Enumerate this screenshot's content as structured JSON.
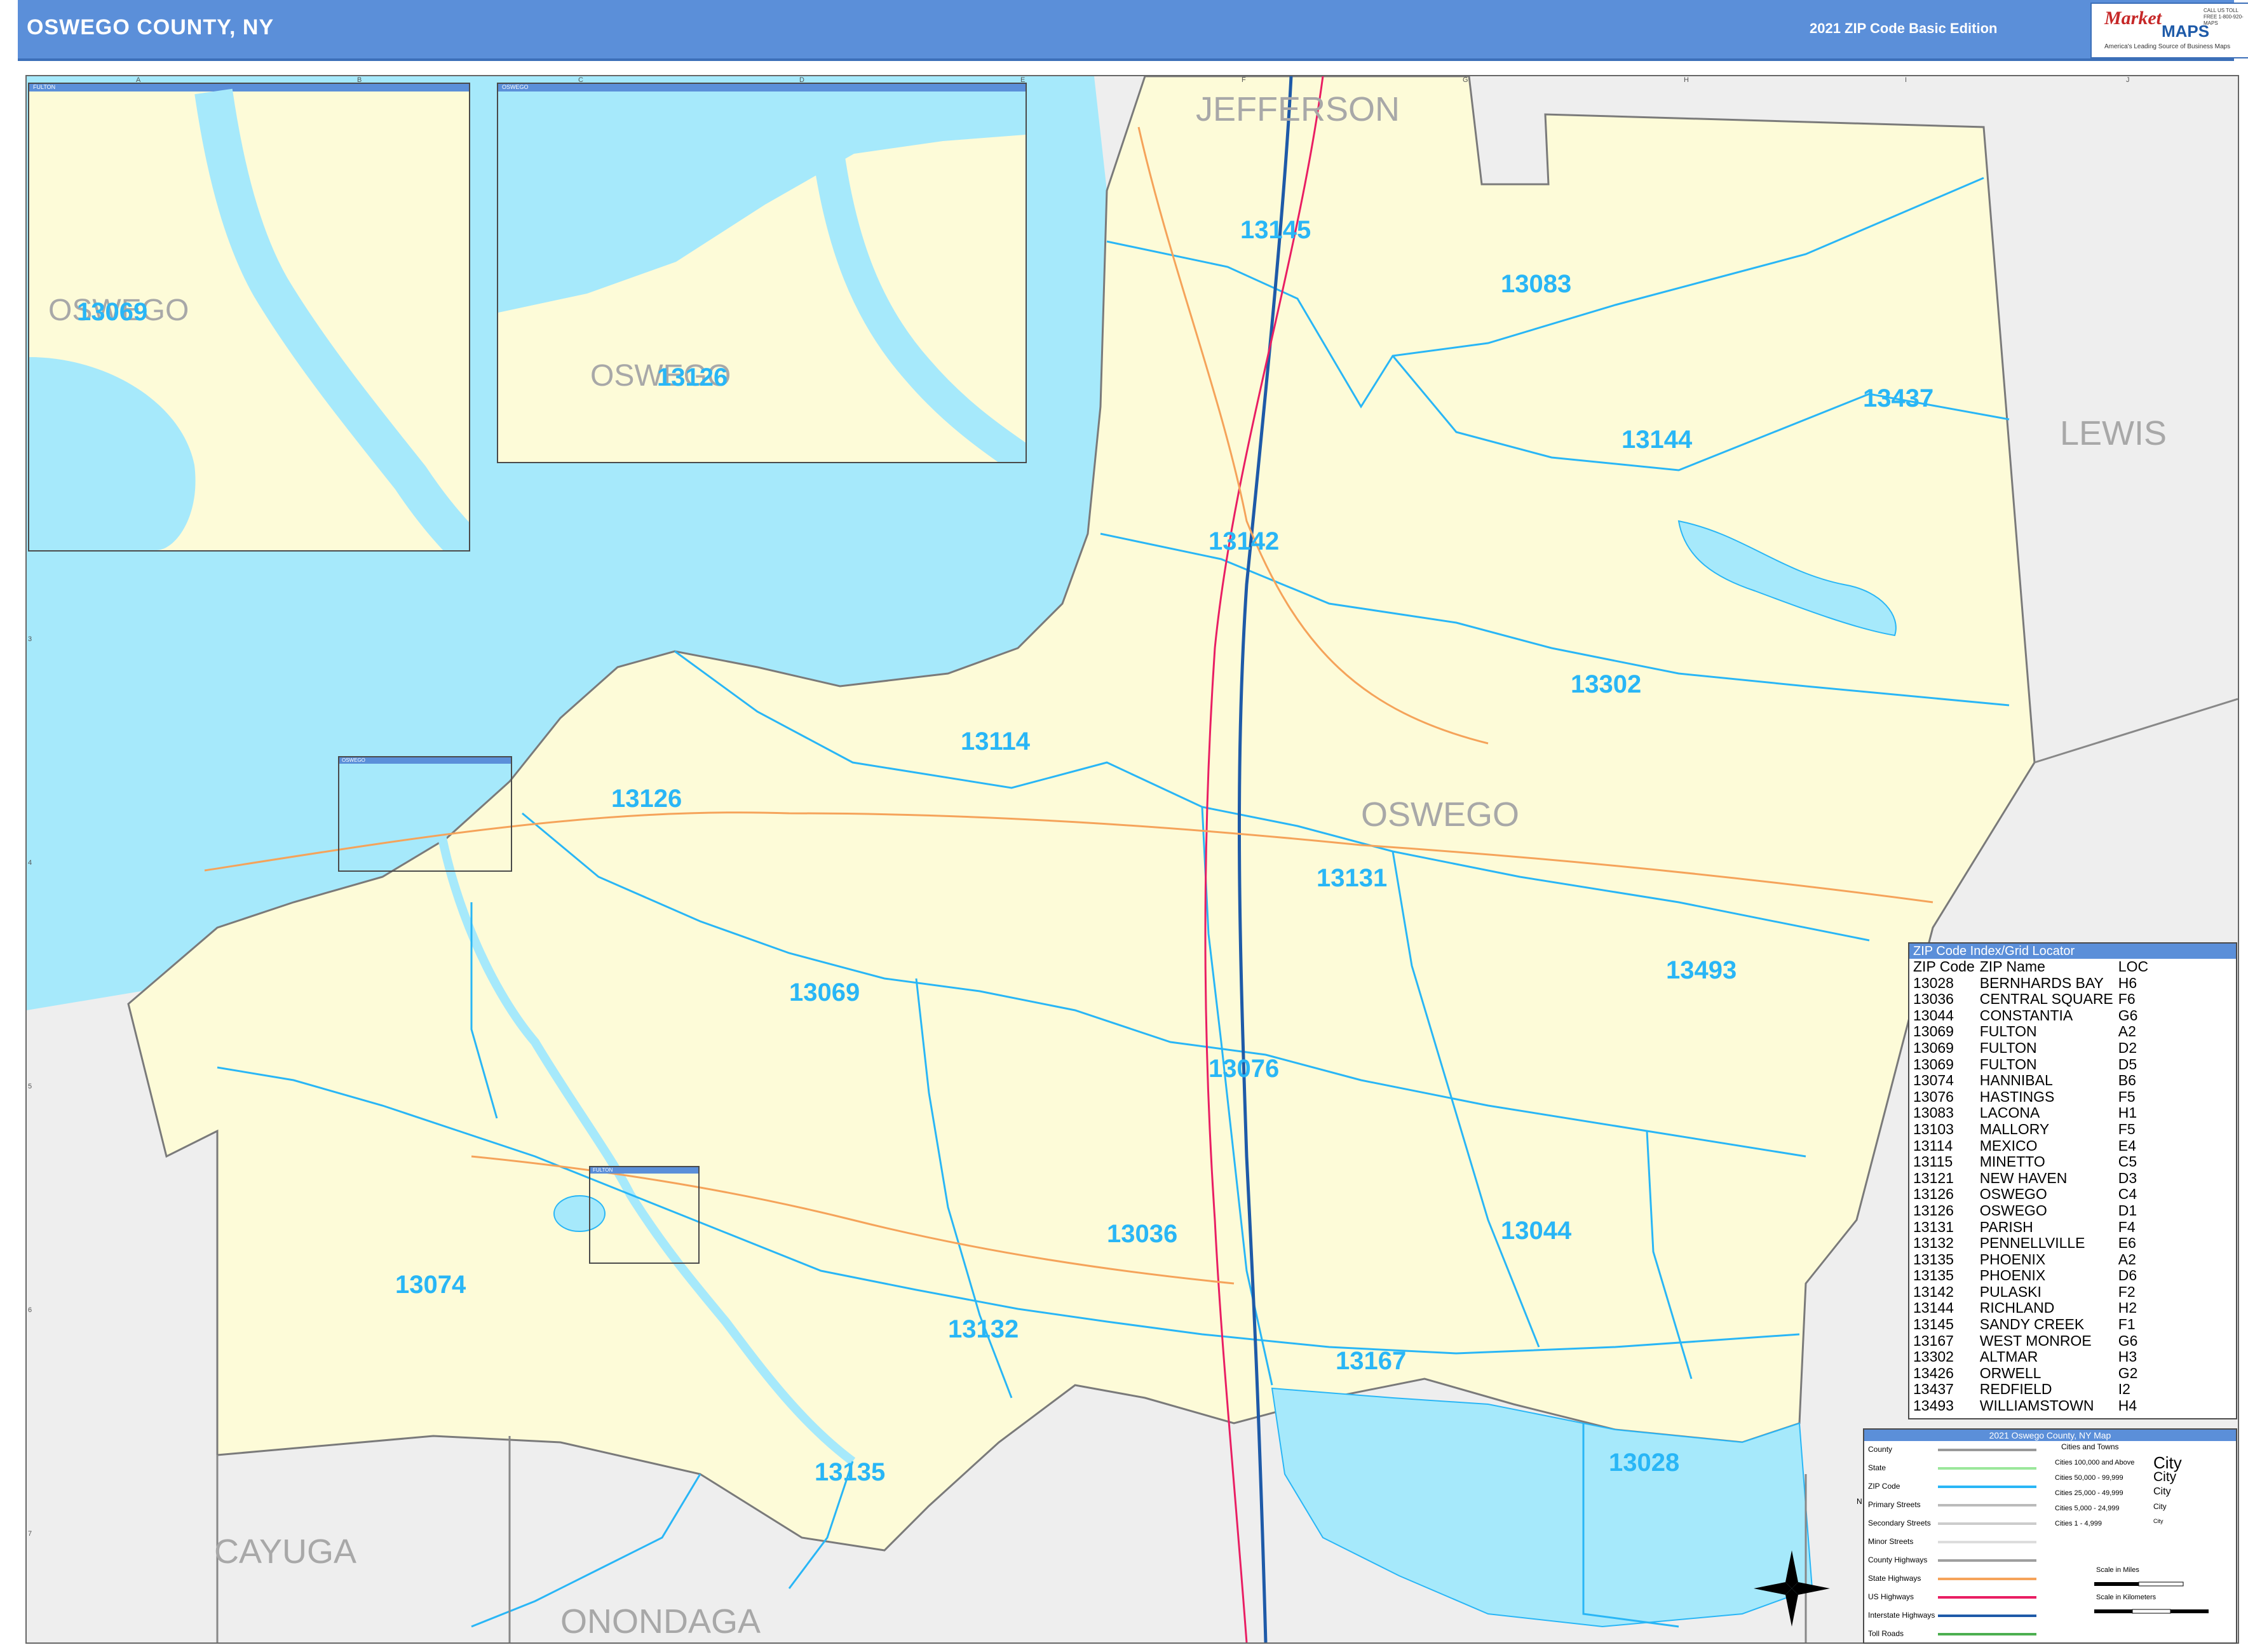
{
  "header": {
    "title": "OSWEGO COUNTY, NY",
    "edition": "2021 ZIP Code Basic Edition",
    "logo_line1": "Market",
    "logo_line2": "MAPS",
    "logo_tagline": "America's Leading Source of Business Maps",
    "logo_contact": "CALL US TOLL FREE 1-800-920-MAPS"
  },
  "map": {
    "counties": {
      "jefferson": "JEFFERSON",
      "lewis": "LEWIS",
      "oswego": "OSWEGO",
      "cayuga": "CAYUGA",
      "onondaga": "ONONDAGA"
    },
    "grid_columns": [
      "A",
      "B",
      "C",
      "D",
      "E",
      "F",
      "G",
      "H",
      "I",
      "J"
    ],
    "grid_rows": [
      "1",
      "2",
      "3",
      "4",
      "5",
      "6",
      "7"
    ],
    "zip_labels": [
      "13145",
      "13083",
      "13437",
      "13144",
      "13142",
      "13302",
      "13114",
      "13126",
      "13131",
      "13493",
      "13069",
      "13076",
      "13036",
      "13044",
      "13074",
      "13132",
      "13167",
      "13028",
      "13135"
    ],
    "insets": {
      "fulton": {
        "name": "FULTON",
        "county_label": "OSWEGO",
        "zip": "13069"
      },
      "oswego": {
        "name": "OSWEGO",
        "county_label": "OSWEGO",
        "zip": "13126"
      },
      "small_oswego": "OSWEGO",
      "small_fulton": "FULTON"
    },
    "colors": {
      "land": "#fdfbd8",
      "water": "#a6e9fb",
      "zip_boundary": "#29b6f6",
      "outside": "#eeeeee",
      "header": "#5b8fd9"
    }
  },
  "zip_index": {
    "title": "ZIP Code Index/Grid Locator",
    "columns": [
      "ZIP Code",
      "ZIP Name",
      "LOC"
    ],
    "rows": [
      [
        "13028",
        "BERNHARDS BAY",
        "H6"
      ],
      [
        "13036",
        "CENTRAL SQUARE",
        "F6"
      ],
      [
        "13044",
        "CONSTANTIA",
        "G6"
      ],
      [
        "13069",
        "FULTON",
        "A2"
      ],
      [
        "13069",
        "FULTON",
        "D2"
      ],
      [
        "13069",
        "FULTON",
        "D5"
      ],
      [
        "13074",
        "HANNIBAL",
        "B6"
      ],
      [
        "13076",
        "HASTINGS",
        "F5"
      ],
      [
        "13083",
        "LACONA",
        "H1"
      ],
      [
        "13103",
        "MALLORY",
        "F5"
      ],
      [
        "13114",
        "MEXICO",
        "E4"
      ],
      [
        "13115",
        "MINETTO",
        "C5"
      ],
      [
        "13121",
        "NEW HAVEN",
        "D3"
      ],
      [
        "13126",
        "OSWEGO",
        "C4"
      ],
      [
        "13126",
        "OSWEGO",
        "D1"
      ],
      [
        "13131",
        "PARISH",
        "F4"
      ],
      [
        "13132",
        "PENNELLVILLE",
        "E6"
      ],
      [
        "13135",
        "PHOENIX",
        "A2"
      ],
      [
        "13135",
        "PHOENIX",
        "D6"
      ],
      [
        "13142",
        "PULASKI",
        "F2"
      ],
      [
        "13144",
        "RICHLAND",
        "H2"
      ],
      [
        "13145",
        "SANDY CREEK",
        "F1"
      ],
      [
        "13167",
        "WEST MONROE",
        "G6"
      ],
      [
        "13302",
        "ALTMAR",
        "H3"
      ],
      [
        "13426",
        "ORWELL",
        "G2"
      ],
      [
        "13437",
        "REDFIELD",
        "I2"
      ],
      [
        "13493",
        "WILLIAMSTOWN",
        "H4"
      ]
    ]
  },
  "legend": {
    "title": "2021 Oswego County, NY Map",
    "cities_header": "Cities and Towns",
    "lines": [
      "County",
      "State",
      "ZIP Code",
      "Primary Streets",
      "Secondary Streets",
      "Minor Streets",
      "County Highways",
      "State Highways",
      "US Highways",
      "Interstate Highways",
      "Toll Roads"
    ],
    "cities": [
      "Cities 100,000 and Above",
      "Cities 50,000 - 99,999",
      "Cities 25,000 - 49,999",
      "Cities 5,000 - 24,999",
      "Cities 1 - 4,999"
    ],
    "city_samples": [
      "City",
      "City",
      "City",
      "City",
      "City"
    ],
    "scale_miles": "Scale in Miles",
    "scale_km": "Scale in Kilometers",
    "compass": {
      "n": "N",
      "s": "S",
      "e": "E",
      "w": "W"
    }
  }
}
